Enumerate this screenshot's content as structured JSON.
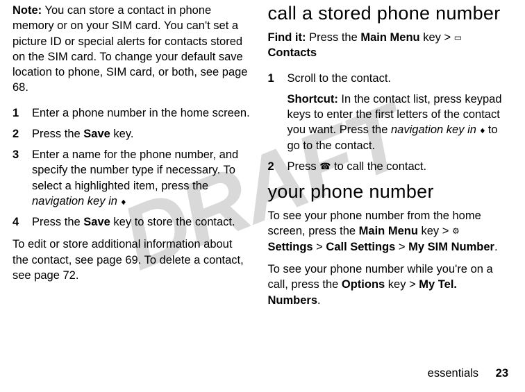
{
  "watermark": "DRAFT",
  "left": {
    "note_label": "Note:",
    "note_text": " You can store a contact in phone memory or on your SIM card. You can't set a picture ID or special alerts for contacts stored on the SIM card. To change your default save location to phone, SIM card, or both, see page 68.",
    "steps": [
      {
        "n": "1",
        "t": "Enter a phone number in the home screen."
      },
      {
        "n": "2",
        "t_a": "Press the ",
        "t_bold": "Save",
        "t_b": " key."
      },
      {
        "n": "3",
        "t_a": "Enter a name for the phone number, and specify the number type if necessary. To select a highlighted item, press the ",
        "t_ital": "navigation key in",
        "glyph": "nav"
      },
      {
        "n": "4",
        "t_a": "Press the ",
        "t_bold": "Save",
        "t_b": " key to store the contact."
      }
    ],
    "tail": "To edit or store additional information about the contact, see page 69. To delete a contact, see page 72."
  },
  "right": {
    "h_call": "call a stored phone number",
    "findit_label": "Find it:",
    "findit_a": " Press the ",
    "findit_key": "Main Menu",
    "findit_b": " key > ",
    "findit_glyph": "contacts",
    "findit_c": " ",
    "findit_contacts": "Contacts",
    "step1": {
      "n": "1",
      "t": "Scroll to the contact."
    },
    "shortcut_label": "Shortcut:",
    "shortcut_a": " In the contact list, press keypad keys to enter the first letters of the contact you want. Press the ",
    "shortcut_ital": "navigation key in",
    "shortcut_b": " to go to the contact.",
    "step2": {
      "n": "2",
      "t_a": "Press ",
      "glyph": "send",
      "t_b": " to call the contact."
    },
    "h_your": "your phone number",
    "para1_a": "To see your phone number from the home screen, press the ",
    "para1_key1": "Main Menu",
    "para1_b": " key > ",
    "para1_glyph": "settings",
    "para1_key2": " Settings",
    "para1_c": " > ",
    "para1_key3": "Call Settings",
    "para1_d": " > ",
    "para1_key4": "My SIM Number",
    "para1_e": ".",
    "para2_a": "To see your phone number while you're on a call, press the ",
    "para2_key1": "Options",
    "para2_b": " key > ",
    "para2_key2": "My Tel. Numbers",
    "para2_c": "."
  },
  "footer": {
    "section": "essentials",
    "page": "23"
  }
}
